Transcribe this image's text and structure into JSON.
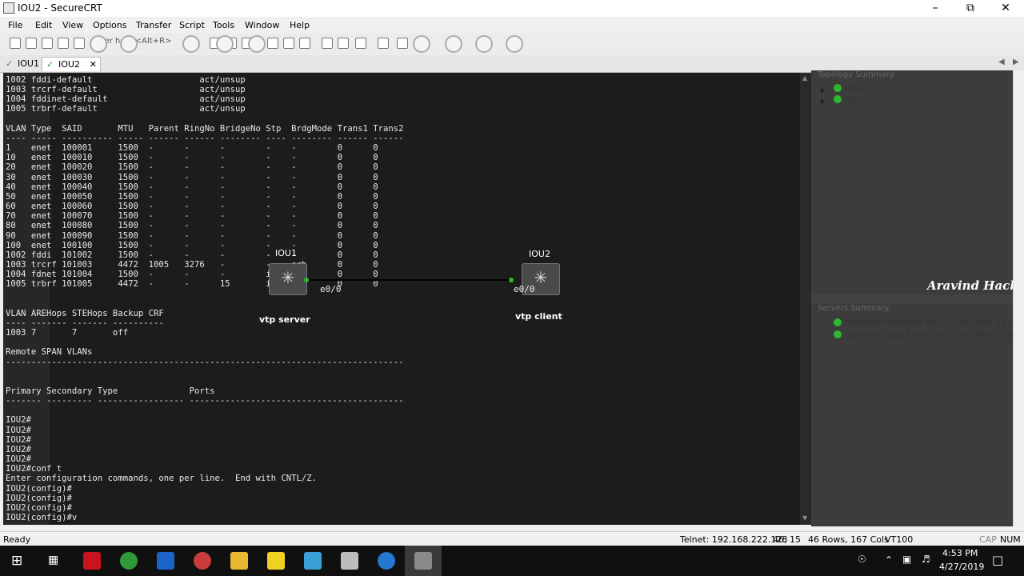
{
  "window": {
    "title": "IOU2 - SecureCRT"
  },
  "menu": [
    "File",
    "Edit",
    "View",
    "Options",
    "Transfer",
    "Script",
    "Tools",
    "Window",
    "Help"
  ],
  "toolbar": {
    "host_placeholder": "Enter host <Alt+R>"
  },
  "tabs": [
    {
      "label": "IOU1",
      "active": false
    },
    {
      "label": "IOU2",
      "active": true
    }
  ],
  "terminal_lines": [
    "1002 fddi-default                     act/unsup",
    "1003 trcrf-default                    act/unsup",
    "1004 fddinet-default                  act/unsup",
    "1005 trbrf-default                    act/unsup",
    "",
    "VLAN Type  SAID       MTU   Parent RingNo BridgeNo Stp  BrdgMode Trans1 Trans2",
    "---- ----- ---------- ----- ------ ------ -------- ---- -------- ------ ------",
    "1    enet  100001     1500  -      -      -        -    -        0      0",
    "10   enet  100010     1500  -      -      -        -    -        0      0",
    "20   enet  100020     1500  -      -      -        -    -        0      0",
    "30   enet  100030     1500  -      -      -        -    -        0      0",
    "40   enet  100040     1500  -      -      -        -    -        0      0",
    "50   enet  100050     1500  -      -      -        -    -        0      0",
    "60   enet  100060     1500  -      -      -        -    -        0      0",
    "70   enet  100070     1500  -      -      -        -    -        0      0",
    "80   enet  100080     1500  -      -      -        -    -        0      0",
    "90   enet  100090     1500  -      -      -        -    -        0      0",
    "100  enet  100100     1500  -      -      -        -    -        0      0",
    "1002 fddi  101002     1500  -      -      -        -    -        0      0",
    "1003 trcrf 101003     4472  1005   3276   -        -    srb      0      0",
    "1004 fdnet 101004     1500  -      -      -        ieee -        0      0",
    "1005 trbrf 101005     4472  -      -      15       ibm  -        0      0",
    "",
    "",
    "VLAN AREHops STEHops Backup CRF",
    "---- ------- ------- ----------",
    "1003 7       7       off",
    "",
    "Remote SPAN VLANs",
    "------------------------------------------------------------------------------",
    "",
    "",
    "Primary Secondary Type              Ports",
    "------- --------- ----------------- ------------------------------------------",
    "",
    "IOU2#",
    "IOU2#",
    "IOU2#",
    "IOU2#",
    "IOU2#",
    "IOU2#conf t",
    "Enter configuration commands, one per line.  End with CNTL/Z.",
    "IOU2(config)#",
    "IOU2(config)#",
    "IOU2(config)#",
    "IOU2(config)#v"
  ],
  "topology_overlay": {
    "device1": {
      "name": "IOU1",
      "desc": "vtp server",
      "port": "e0/0"
    },
    "device2": {
      "name": "IOU2",
      "desc": "vtp client",
      "port": "e0/0"
    }
  },
  "side_panel": {
    "topology_title": "Topology Summary",
    "topology_items": [
      "IOU1",
      "IOU2"
    ],
    "brand": "Aravind Hack",
    "servers_title": "Servers Summary",
    "servers": [
      "DESKTOP-FRDRAM4 CPU 20.3%, RAM 46.9%",
      "GN53 VM (GNS3 VM) CPU 1.0%, RAM 23.8%"
    ]
  },
  "status": {
    "ready": "Ready",
    "telnet": "Telnet: 192.168.222.128",
    "cursor": "46, 15",
    "size": "46 Rows, 167 Cols",
    "emulation": "VT100",
    "cap": "CAP",
    "num": "NUM"
  },
  "taskbar": {
    "time": "4:53 PM",
    "date": "4/27/2019"
  },
  "colors": {
    "terminal_bg": "#1c1c1c",
    "terminal_fg": "#e8e8e8",
    "link_up": "#2db82d",
    "panel_bg": "#3c3c3c"
  }
}
